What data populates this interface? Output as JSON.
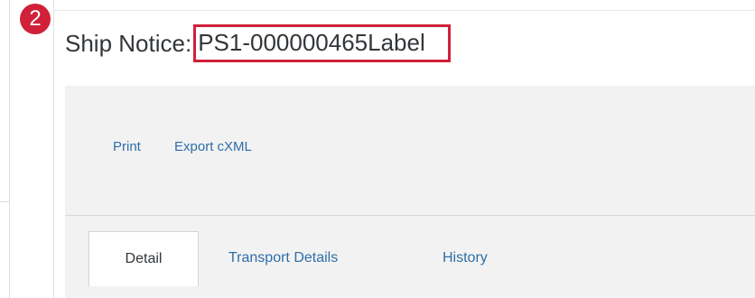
{
  "annotation": {
    "step_number": "2",
    "highlight_color": "#d0203a"
  },
  "header": {
    "title_prefix": "Ship Notice:",
    "document_id": "PS1-000000465Label"
  },
  "actions": {
    "print_label": "Print",
    "export_label": "Export cXML"
  },
  "tabs": [
    {
      "label": "Detail",
      "active": true
    },
    {
      "label": "Transport Details",
      "active": false
    },
    {
      "label": "History",
      "active": false
    }
  ],
  "colors": {
    "link": "#2e6ea8",
    "text": "#32363a",
    "toolbar_background": "#f2f2f2"
  }
}
